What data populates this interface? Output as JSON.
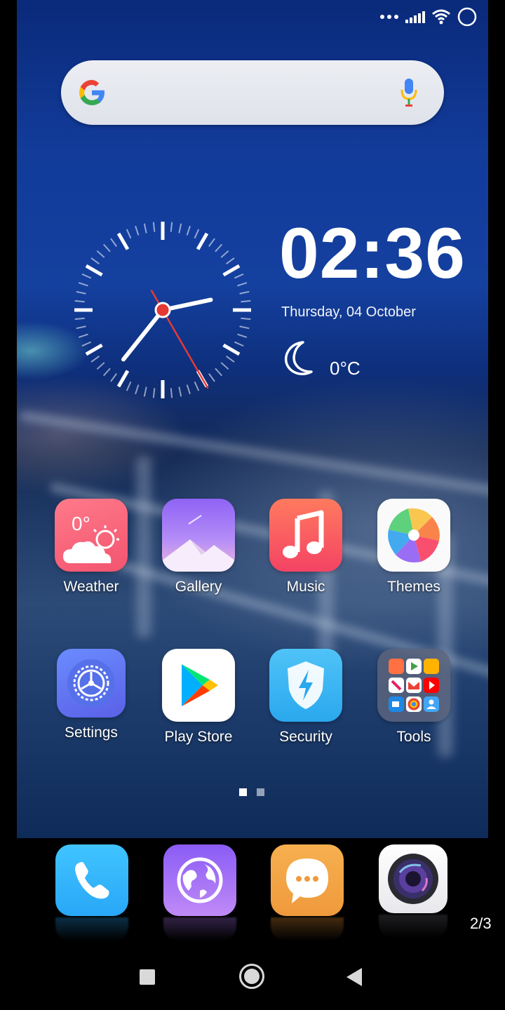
{
  "status_bar": {
    "icons": [
      "dots-icon",
      "signal-icon",
      "wifi-icon",
      "circle-icon"
    ]
  },
  "search": {
    "brand_icon": "google-g-icon",
    "voice_icon": "mic-icon"
  },
  "clock_widget": {
    "time": "02:36",
    "date": "Thursday, 04 October",
    "weather_icon": "moon-icon",
    "temperature": "0°C",
    "analog": {
      "hour": 2,
      "minute": 36,
      "second": 25
    }
  },
  "apps": [
    {
      "label": "Weather",
      "icon": "weather-icon",
      "badge": "0°"
    },
    {
      "label": "Gallery",
      "icon": "gallery-icon"
    },
    {
      "label": "Music",
      "icon": "music-icon"
    },
    {
      "label": "Themes",
      "icon": "themes-icon"
    },
    {
      "label": "Settings",
      "icon": "settings-icon"
    },
    {
      "label": "Play Store",
      "icon": "play-store-icon"
    },
    {
      "label": "Security",
      "icon": "security-icon"
    },
    {
      "label": "Tools",
      "icon": "tools-folder-icon"
    }
  ],
  "pager": {
    "pages": 2,
    "current": 1
  },
  "dock": [
    {
      "name": "phone",
      "icon": "phone-icon"
    },
    {
      "name": "browser",
      "icon": "globe-icon"
    },
    {
      "name": "messages",
      "icon": "chat-bubble-icon"
    },
    {
      "name": "camera",
      "icon": "camera-lens-icon"
    }
  ],
  "page_counter": "2/3",
  "nav": {
    "recent": "square-icon",
    "home": "circle-home-icon",
    "back": "triangle-back-icon"
  },
  "colors": {
    "accent_red": "#e53935",
    "wallpaper_blue": "#123b9a"
  }
}
